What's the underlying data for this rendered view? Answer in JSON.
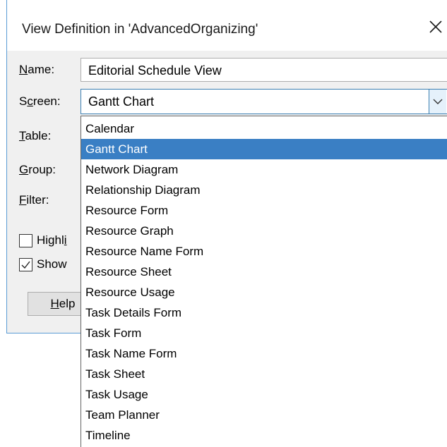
{
  "dialog": {
    "title": "View Definition in 'AdvancedOrganizing'",
    "close_label": "Close"
  },
  "fields": {
    "name_label_accel": "N",
    "name_label_rest": "ame:",
    "name_value": "Editorial Schedule View",
    "screen_label_pre": "S",
    "screen_label_accel": "c",
    "screen_label_rest": "reen:",
    "screen_value": "Gantt Chart",
    "table_label_accel": "T",
    "table_label_rest": "able:",
    "group_label_accel": "G",
    "group_label_rest": "roup:",
    "filter_label_accel": "F",
    "filter_label_rest": "ilter:"
  },
  "checkboxes": {
    "highlight_pre": "Highl",
    "highlight_accel": "i",
    "show_label": "Show",
    "highlight_checked": false,
    "show_checked": true
  },
  "buttons": {
    "help_accel": "H",
    "help_rest": "elp"
  },
  "dropdown": {
    "selected_index": 1,
    "options": [
      "Calendar",
      "Gantt Chart",
      "Network Diagram",
      "Relationship Diagram",
      "Resource Form",
      "Resource Graph",
      "Resource Name Form",
      "Resource Sheet",
      "Resource Usage",
      "Task Details Form",
      "Task Form",
      "Task Name Form",
      "Task Sheet",
      "Task Usage",
      "Team Planner",
      "Timeline"
    ]
  },
  "colors": {
    "selection": "#3a7fc4",
    "dialog_bg": "#f0f0f0",
    "focus_border": "#3c7fb1"
  }
}
